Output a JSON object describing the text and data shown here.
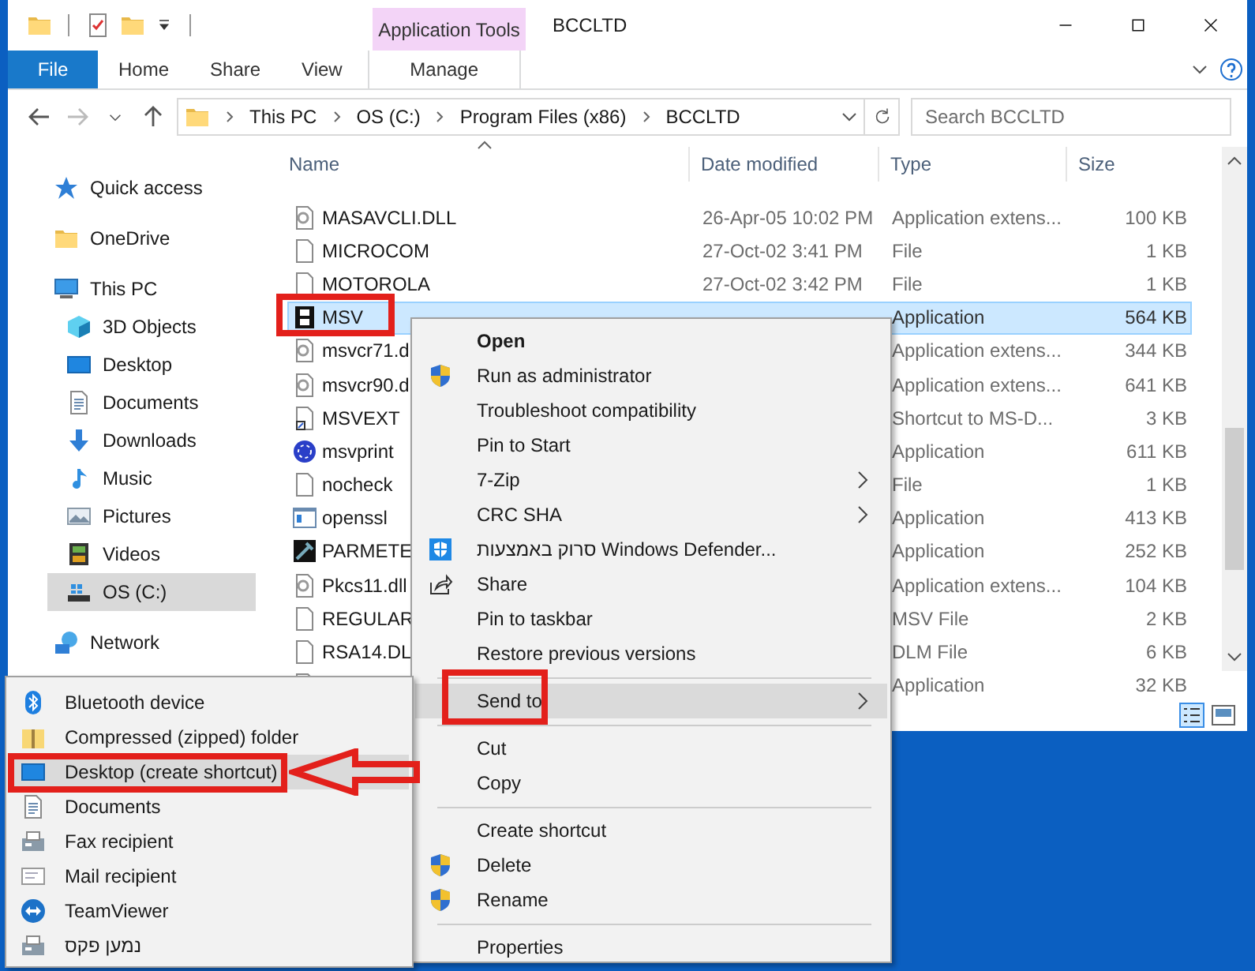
{
  "window": {
    "context_tab": "Application Tools",
    "title": "BCCLTD"
  },
  "ribbon_tabs": [
    {
      "label": "File",
      "kind": "file"
    },
    {
      "label": "Home",
      "kind": "tab"
    },
    {
      "label": "Share",
      "kind": "tab"
    },
    {
      "label": "View",
      "kind": "tab"
    },
    {
      "label": "Manage",
      "kind": "context"
    }
  ],
  "address_bar": {
    "crumbs": [
      "This PC",
      "OS (C:)",
      "Program Files (x86)",
      "BCCLTD"
    ]
  },
  "search": {
    "placeholder": "Search BCCLTD"
  },
  "sidebar": {
    "items": [
      {
        "label": "Quick access",
        "kind": "star",
        "selected": false
      },
      {
        "label": "OneDrive",
        "kind": "folder",
        "selected": false
      },
      {
        "label": "This PC",
        "kind": "pc",
        "selected": false,
        "children": [
          {
            "label": "3D Objects",
            "kind": "cube",
            "selected": false
          },
          {
            "label": "Desktop",
            "kind": "desktop",
            "selected": false
          },
          {
            "label": "Documents",
            "kind": "document",
            "selected": false
          },
          {
            "label": "Downloads",
            "kind": "download",
            "selected": false
          },
          {
            "label": "Music",
            "kind": "music",
            "selected": false
          },
          {
            "label": "Pictures",
            "kind": "pictures",
            "selected": false
          },
          {
            "label": "Videos",
            "kind": "videos",
            "selected": false
          },
          {
            "label": "OS (C:)",
            "kind": "drive",
            "selected": true
          }
        ]
      },
      {
        "label": "Network",
        "kind": "network",
        "selected": false
      }
    ]
  },
  "table": {
    "columns": [
      "Name",
      "Date modified",
      "Type",
      "Size"
    ],
    "rows": [
      {
        "name": "MASAVCLI.DLL",
        "kind": "dll",
        "date": "26-Apr-05 10:02 PM",
        "type": "Application extens...",
        "size": "100 KB",
        "selected": false
      },
      {
        "name": "MICROCOM",
        "kind": "file",
        "date": "27-Oct-02 3:41 PM",
        "type": "File",
        "size": "1 KB",
        "selected": false
      },
      {
        "name": "MOTOROLA",
        "kind": "file",
        "date": "27-Oct-02 3:42 PM",
        "type": "File",
        "size": "1 KB",
        "selected": false
      },
      {
        "name": "MSV",
        "kind": "msv",
        "type": "Application",
        "size": "564 KB",
        "selected": true
      },
      {
        "name": "msvcr71.d",
        "kind": "dll",
        "type": "Application extens...",
        "size": "344 KB",
        "selected": false
      },
      {
        "name": "msvcr90.d",
        "kind": "dll",
        "type": "Application extens...",
        "size": "641 KB",
        "selected": false
      },
      {
        "name": "MSVEXT",
        "kind": "shortcut",
        "type": "Shortcut to MS-D...",
        "size": "3 KB",
        "selected": false
      },
      {
        "name": "msvprint",
        "kind": "globe",
        "type": "Application",
        "size": "611 KB",
        "selected": false
      },
      {
        "name": "nocheck",
        "kind": "file",
        "type": "File",
        "size": "1 KB",
        "selected": false
      },
      {
        "name": "openssl",
        "kind": "window",
        "type": "Application",
        "size": "413 KB",
        "selected": false
      },
      {
        "name": "PARMETE",
        "kind": "tool",
        "type": "Application",
        "size": "252 KB",
        "selected": false
      },
      {
        "name": "Pkcs11.dll",
        "kind": "dll",
        "type": "Application extens...",
        "size": "104 KB",
        "selected": false
      },
      {
        "name": "REGULAR",
        "kind": "file",
        "type": "MSV File",
        "size": "2 KB",
        "selected": false
      },
      {
        "name": "RSA14.DL",
        "kind": "file",
        "type": "DLM File",
        "size": "6 KB",
        "selected": false
      },
      {
        "kind": "file",
        "type": "Application",
        "size": "32 KB",
        "selected": false
      }
    ]
  },
  "context_menu": {
    "items": [
      {
        "label": "Open",
        "kind": "plain",
        "default": true,
        "submenu": false,
        "selected": false
      },
      {
        "label": "Run as administrator",
        "kind": "uac",
        "default": false,
        "submenu": false,
        "selected": false
      },
      {
        "label": "Troubleshoot compatibility",
        "kind": "plain",
        "default": false,
        "submenu": false,
        "selected": false
      },
      {
        "label": "Pin to Start",
        "kind": "plain",
        "default": false,
        "submenu": false,
        "selected": false
      },
      {
        "label": "7-Zip",
        "kind": "plain",
        "default": false,
        "submenu": true,
        "selected": false
      },
      {
        "label": "CRC SHA",
        "kind": "plain",
        "default": false,
        "submenu": true,
        "selected": false
      },
      {
        "label": "סרוק באמצעות Windows Defender...",
        "kind": "defender",
        "default": false,
        "submenu": false,
        "selected": false
      },
      {
        "label": "Share",
        "kind": "share",
        "default": false,
        "submenu": false,
        "selected": false
      },
      {
        "label": "Pin to taskbar",
        "kind": "plain",
        "default": false,
        "submenu": false,
        "selected": false
      },
      {
        "label": "Restore previous versions",
        "kind": "plain",
        "default": false,
        "submenu": false,
        "selected": false
      },
      {
        "kind": "separator"
      },
      {
        "label": "Send to",
        "kind": "plain",
        "default": false,
        "submenu": true,
        "selected": true
      },
      {
        "kind": "separator"
      },
      {
        "label": "Cut",
        "kind": "plain",
        "default": false,
        "submenu": false,
        "selected": false
      },
      {
        "label": "Copy",
        "kind": "plain",
        "default": false,
        "submenu": false,
        "selected": false
      },
      {
        "kind": "separator"
      },
      {
        "label": "Create shortcut",
        "kind": "plain",
        "default": false,
        "submenu": false,
        "selected": false
      },
      {
        "label": "Delete",
        "kind": "uac",
        "default": false,
        "submenu": false,
        "selected": false
      },
      {
        "label": "Rename",
        "kind": "uac",
        "default": false,
        "submenu": false,
        "selected": false
      },
      {
        "kind": "separator"
      },
      {
        "label": "Properties",
        "kind": "plain",
        "default": false,
        "submenu": false,
        "selected": false
      }
    ]
  },
  "send_to_menu": {
    "items": [
      {
        "label": "Bluetooth device",
        "kind": "bluetooth",
        "selected": false
      },
      {
        "label": "Compressed (zipped) folder",
        "kind": "zip",
        "selected": false
      },
      {
        "label": "Desktop (create shortcut)",
        "kind": "desktop",
        "selected": true
      },
      {
        "label": "Documents",
        "kind": "document",
        "selected": false
      },
      {
        "label": "Fax recipient",
        "kind": "fax",
        "selected": false
      },
      {
        "label": "Mail recipient",
        "kind": "mail",
        "selected": false
      },
      {
        "label": "TeamViewer",
        "kind": "teamviewer",
        "selected": false
      },
      {
        "label": "נמען פקס",
        "kind": "fax",
        "selected": false
      }
    ]
  }
}
